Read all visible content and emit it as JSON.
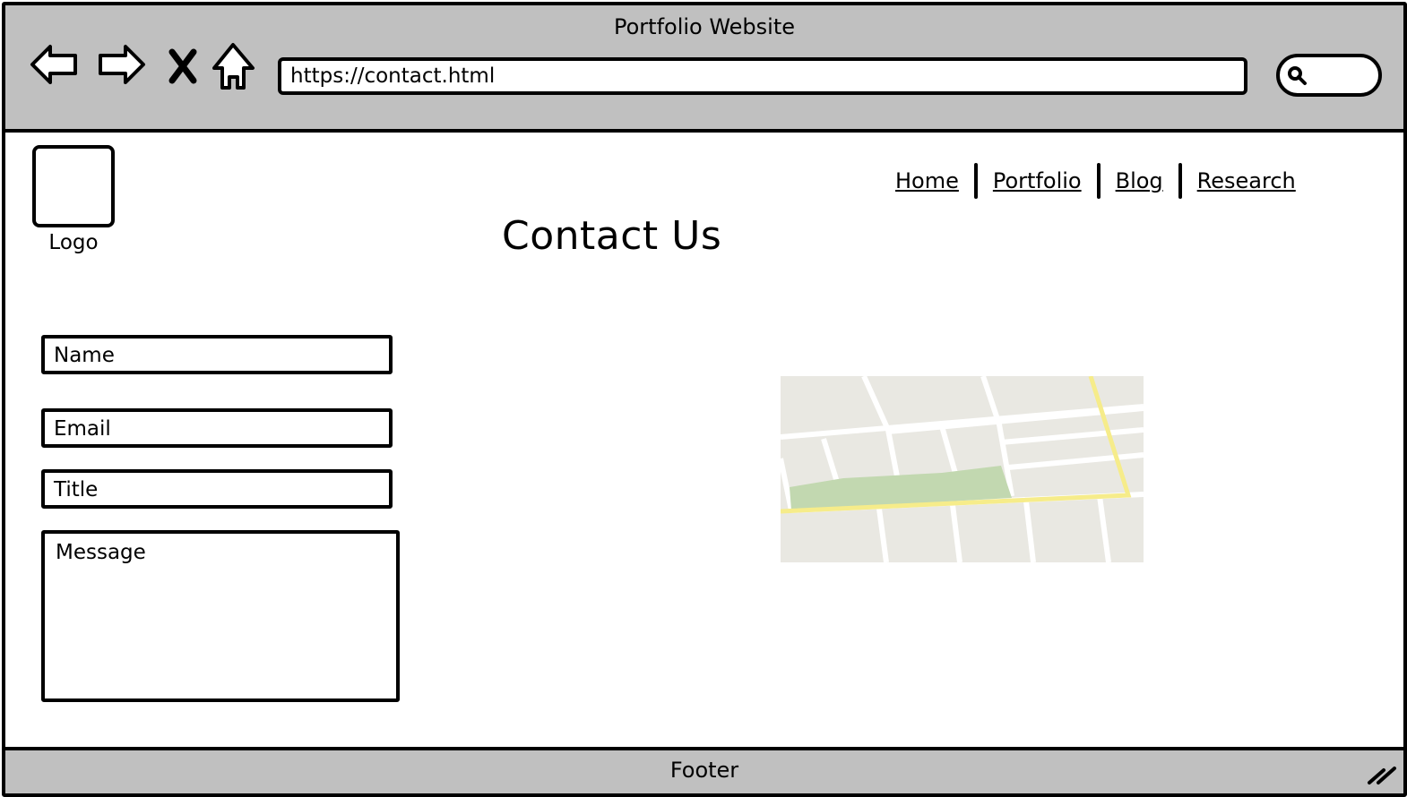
{
  "window": {
    "title": "Portfolio Website"
  },
  "browser": {
    "back_icon": "arrow-left-icon",
    "forward_icon": "arrow-right-icon",
    "close_icon": "x-icon",
    "home_icon": "home-icon",
    "url": "https://contact.html",
    "search_icon": "search-icon"
  },
  "logo": {
    "label": "Logo"
  },
  "nav": {
    "items": [
      {
        "label": "Home"
      },
      {
        "label": "Portfolio"
      },
      {
        "label": "Blog"
      },
      {
        "label": "Research"
      }
    ]
  },
  "page": {
    "heading": "Contact Us"
  },
  "form": {
    "name_placeholder": "Name",
    "email_placeholder": "Email",
    "title_placeholder": "Title",
    "message_placeholder": "Message"
  },
  "map": {
    "icon": "map-image",
    "colors": {
      "land": "#e9e8e2",
      "road": "#ffffff",
      "highway": "#f6ec8a",
      "park": "#c2d8b0"
    }
  },
  "footer": {
    "label": "Footer",
    "resize_icon": "resize-grip-icon"
  },
  "colors": {
    "chrome": "#c0c0c0",
    "border": "#000000",
    "background": "#ffffff"
  }
}
